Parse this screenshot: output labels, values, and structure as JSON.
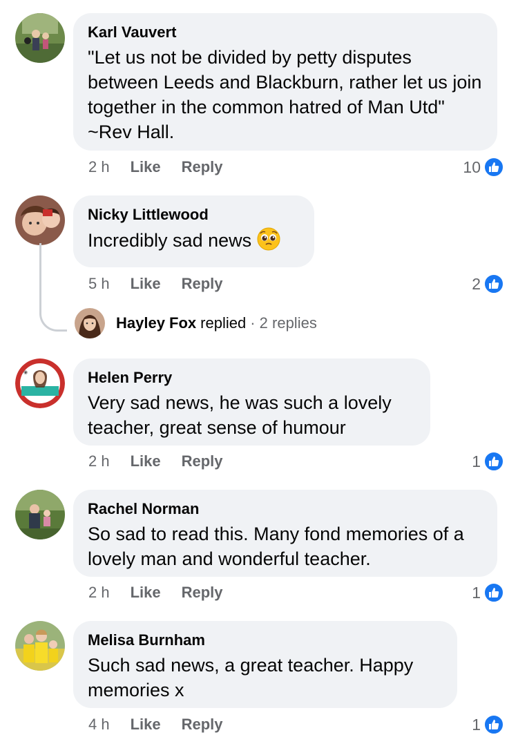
{
  "comments": [
    {
      "author": "Karl Vauvert",
      "text": "\"Let us not be divided by petty disputes between Leeds and Blackburn, rather let us join together in the common hatred of Man Utd\" ~Rev Hall.",
      "time": "2 h",
      "like_label": "Like",
      "reply_label": "Reply",
      "likes": "10"
    },
    {
      "author": "Nicky Littlewood",
      "text": "Incredibly sad news",
      "emoji": "pleading-face-emoji",
      "time": "5 h",
      "like_label": "Like",
      "reply_label": "Reply",
      "likes": "2",
      "reply_summary": {
        "name": "Hayley Fox",
        "verb": "replied",
        "count": "· 2 replies"
      }
    },
    {
      "author": "Helen Perry",
      "text": "Very sad news, he was such a lovely teacher, great sense of humour",
      "time": "2 h",
      "like_label": "Like",
      "reply_label": "Reply",
      "likes": "1"
    },
    {
      "author": "Rachel Norman",
      "text": "So sad to read this. Many fond memories of a lovely man and wonderful teacher.",
      "time": "2 h",
      "like_label": "Like",
      "reply_label": "Reply",
      "likes": "1"
    },
    {
      "author": "Melisa Burnham",
      "text": "Such sad news, a great teacher. Happy memories x",
      "time": "4 h",
      "like_label": "Like",
      "reply_label": "Reply",
      "likes": "1"
    }
  ],
  "colors": {
    "bubble": "#f0f2f5",
    "meta": "#65676b",
    "like_blue": "#1877f2"
  },
  "icons": {
    "like": "thumbs-up-icon"
  }
}
